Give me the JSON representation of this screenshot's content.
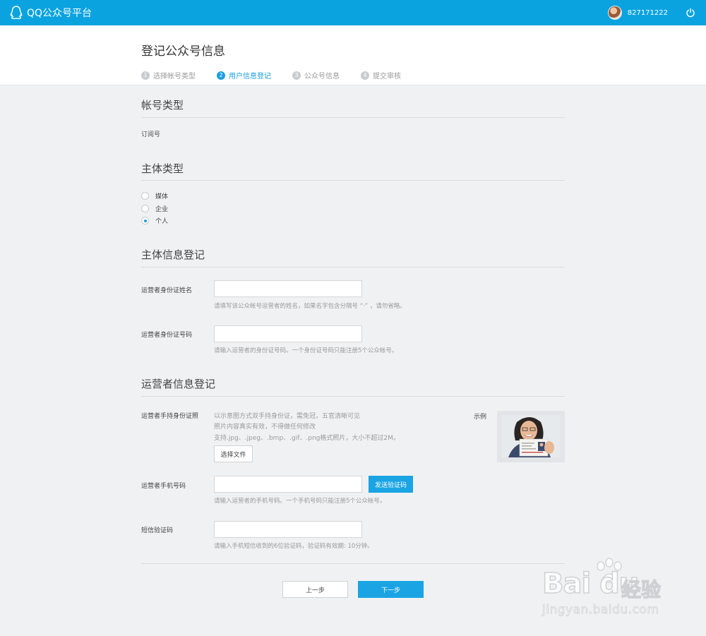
{
  "topbar": {
    "app_title": "QQ公众号平台",
    "user_id": "827171222"
  },
  "header": {
    "page_title": "登记公众号信息",
    "steps": [
      {
        "num": "1",
        "label": "选择帐号类型"
      },
      {
        "num": "2",
        "label": "用户信息登记"
      },
      {
        "num": "3",
        "label": "公众号信息"
      },
      {
        "num": "4",
        "label": "提交审核"
      }
    ]
  },
  "account_type": {
    "title": "帐号类型",
    "value": "订阅号"
  },
  "subject_type": {
    "title": "主体类型",
    "options": [
      "媒体",
      "企业",
      "个人"
    ],
    "selected": "个人"
  },
  "subject_info": {
    "title": "主体信息登记",
    "name_label": "运营者身份证姓名",
    "name_value": "",
    "name_hint": "请填写该公众帐号运营者的姓名，如果名字包含分隔号 “·” ，请勿省略。",
    "id_label": "运营者身份证号码",
    "id_value": "",
    "id_hint": "请输入运营者的身份证号码。一个身份证号码只能注册5个公众帐号。"
  },
  "operator_info": {
    "title": "运营者信息登记",
    "photo_label": "运营者手持身份证照",
    "photo_desc": [
      "以示意图方式双手持身份证，需免冠，五官清晰可见",
      "照片内容真实有效，不得做任何修改",
      "支持.jpg、.jpeg、.bmp、.gif、.png格式照片，大小不超过2M。"
    ],
    "choose_file": "选择文件",
    "example_label": "示例",
    "phone_label": "运营者手机号码",
    "phone_value": "",
    "send_code": "发送验证码",
    "phone_hint": "请输入运营者的手机号码。一个手机号码只能注册5个公众帐号。",
    "sms_label": "短信验证码",
    "sms_value": "",
    "sms_hint": "请输入手机短信收到的6位验证码，验证码有效期: 10分钟。"
  },
  "footer": {
    "prev": "上一步",
    "next": "下一步"
  },
  "watermark": {
    "brand": "Bai du",
    "cn": "经验",
    "url": "jingyan.baidu.com"
  },
  "colors": {
    "topbar": "#0aa3e0",
    "accent": "#1a9fe0",
    "primary_button": "#1aa4e4"
  },
  "icons": {
    "logo": "qq-penguin-icon",
    "power": "power-icon"
  }
}
